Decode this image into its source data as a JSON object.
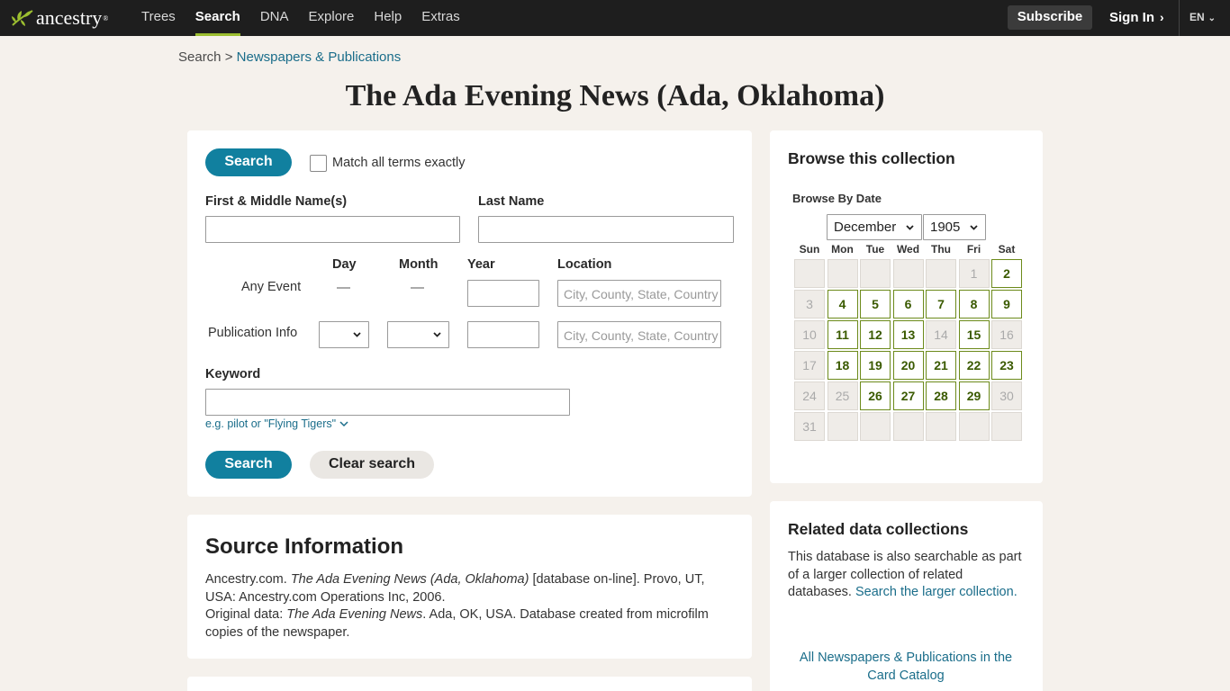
{
  "nav": {
    "logo_text": "ancestry",
    "logo_tm": "®",
    "links": [
      "Trees",
      "Search",
      "DNA",
      "Explore",
      "Help",
      "Extras"
    ],
    "active": "Search",
    "subscribe": "Subscribe",
    "signin": "Sign In",
    "lang": "EN"
  },
  "breadcrumb": {
    "root": "Search",
    "sep": ">",
    "current": "Newspapers & Publications"
  },
  "title": "The Ada Evening News (Ada, Oklahoma)",
  "search": {
    "search_button": "Search",
    "match_label": "Match all terms exactly",
    "first_name_label": "First & Middle Name(s)",
    "last_name_label": "Last Name",
    "day_label": "Day",
    "month_label": "Month",
    "year_label": "Year",
    "location_label": "Location",
    "any_event_label": "Any Event",
    "publication_label": "Publication Info",
    "dash": "—",
    "location_placeholder": "City, County, State, Country",
    "keyword_label": "Keyword",
    "keyword_hint": "e.g. pilot or \"Flying Tigers\"",
    "clear_button": "Clear search"
  },
  "browse": {
    "title": "Browse this collection",
    "by_date": "Browse By Date",
    "month": "December",
    "year": "1905",
    "weekdays": [
      "Sun",
      "Mon",
      "Tue",
      "Wed",
      "Thu",
      "Fri",
      "Sat"
    ],
    "days": [
      {
        "d": "",
        "on": false
      },
      {
        "d": "",
        "on": false
      },
      {
        "d": "",
        "on": false
      },
      {
        "d": "",
        "on": false
      },
      {
        "d": "",
        "on": false
      },
      {
        "d": "1",
        "on": false
      },
      {
        "d": "2",
        "on": true
      },
      {
        "d": "3",
        "on": false
      },
      {
        "d": "4",
        "on": true
      },
      {
        "d": "5",
        "on": true
      },
      {
        "d": "6",
        "on": true
      },
      {
        "d": "7",
        "on": true
      },
      {
        "d": "8",
        "on": true
      },
      {
        "d": "9",
        "on": true
      },
      {
        "d": "10",
        "on": false
      },
      {
        "d": "11",
        "on": true
      },
      {
        "d": "12",
        "on": true
      },
      {
        "d": "13",
        "on": true
      },
      {
        "d": "14",
        "on": false
      },
      {
        "d": "15",
        "on": true
      },
      {
        "d": "16",
        "on": false
      },
      {
        "d": "17",
        "on": false
      },
      {
        "d": "18",
        "on": true
      },
      {
        "d": "19",
        "on": true
      },
      {
        "d": "20",
        "on": true
      },
      {
        "d": "21",
        "on": true
      },
      {
        "d": "22",
        "on": true
      },
      {
        "d": "23",
        "on": true
      },
      {
        "d": "24",
        "on": false
      },
      {
        "d": "25",
        "on": false
      },
      {
        "d": "26",
        "on": true
      },
      {
        "d": "27",
        "on": true
      },
      {
        "d": "28",
        "on": true
      },
      {
        "d": "29",
        "on": true
      },
      {
        "d": "30",
        "on": false
      },
      {
        "d": "31",
        "on": false
      },
      {
        "d": "",
        "on": false
      },
      {
        "d": "",
        "on": false
      },
      {
        "d": "",
        "on": false
      },
      {
        "d": "",
        "on": false
      },
      {
        "d": "",
        "on": false
      },
      {
        "d": "",
        "on": false
      }
    ]
  },
  "source": {
    "title": "Source Information",
    "line1_a": "Ancestry.com. ",
    "line1_i": "The Ada Evening News (Ada, Oklahoma)",
    "line1_b": " [database on-line]. Provo, UT, USA: Ancestry.com Operations Inc, 2006.",
    "line2_a": "Original data: ",
    "line2_i": "The Ada Evening News",
    "line2_b": ". Ada, OK, USA. Database created from microfilm copies of the newspaper."
  },
  "related": {
    "title": "Related data collections",
    "text": "This database is also searchable as part of a larger collection of related databases. ",
    "link": "Search the larger collection.",
    "catalog_link": "All Newspapers & Publications in the Card Catalog"
  }
}
